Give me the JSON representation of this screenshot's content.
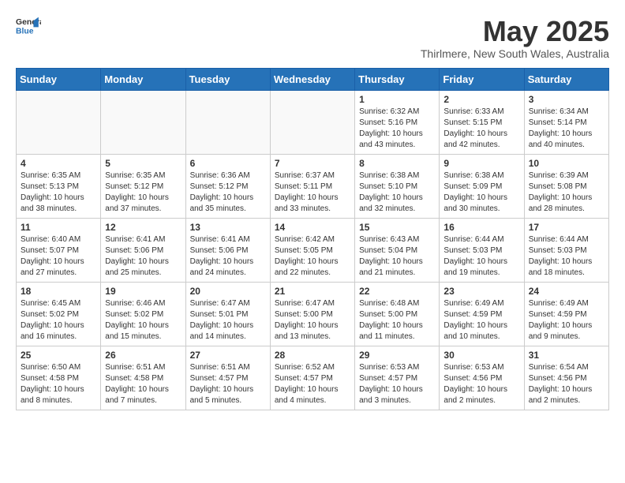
{
  "logo": {
    "line1": "General",
    "line2": "Blue"
  },
  "title": "May 2025",
  "subtitle": "Thirlmere, New South Wales, Australia",
  "days_header": [
    "Sunday",
    "Monday",
    "Tuesday",
    "Wednesday",
    "Thursday",
    "Friday",
    "Saturday"
  ],
  "weeks": [
    [
      {
        "num": "",
        "info": ""
      },
      {
        "num": "",
        "info": ""
      },
      {
        "num": "",
        "info": ""
      },
      {
        "num": "",
        "info": ""
      },
      {
        "num": "1",
        "info": "Sunrise: 6:32 AM\nSunset: 5:16 PM\nDaylight: 10 hours\nand 43 minutes."
      },
      {
        "num": "2",
        "info": "Sunrise: 6:33 AM\nSunset: 5:15 PM\nDaylight: 10 hours\nand 42 minutes."
      },
      {
        "num": "3",
        "info": "Sunrise: 6:34 AM\nSunset: 5:14 PM\nDaylight: 10 hours\nand 40 minutes."
      }
    ],
    [
      {
        "num": "4",
        "info": "Sunrise: 6:35 AM\nSunset: 5:13 PM\nDaylight: 10 hours\nand 38 minutes."
      },
      {
        "num": "5",
        "info": "Sunrise: 6:35 AM\nSunset: 5:12 PM\nDaylight: 10 hours\nand 37 minutes."
      },
      {
        "num": "6",
        "info": "Sunrise: 6:36 AM\nSunset: 5:12 PM\nDaylight: 10 hours\nand 35 minutes."
      },
      {
        "num": "7",
        "info": "Sunrise: 6:37 AM\nSunset: 5:11 PM\nDaylight: 10 hours\nand 33 minutes."
      },
      {
        "num": "8",
        "info": "Sunrise: 6:38 AM\nSunset: 5:10 PM\nDaylight: 10 hours\nand 32 minutes."
      },
      {
        "num": "9",
        "info": "Sunrise: 6:38 AM\nSunset: 5:09 PM\nDaylight: 10 hours\nand 30 minutes."
      },
      {
        "num": "10",
        "info": "Sunrise: 6:39 AM\nSunset: 5:08 PM\nDaylight: 10 hours\nand 28 minutes."
      }
    ],
    [
      {
        "num": "11",
        "info": "Sunrise: 6:40 AM\nSunset: 5:07 PM\nDaylight: 10 hours\nand 27 minutes."
      },
      {
        "num": "12",
        "info": "Sunrise: 6:41 AM\nSunset: 5:06 PM\nDaylight: 10 hours\nand 25 minutes."
      },
      {
        "num": "13",
        "info": "Sunrise: 6:41 AM\nSunset: 5:06 PM\nDaylight: 10 hours\nand 24 minutes."
      },
      {
        "num": "14",
        "info": "Sunrise: 6:42 AM\nSunset: 5:05 PM\nDaylight: 10 hours\nand 22 minutes."
      },
      {
        "num": "15",
        "info": "Sunrise: 6:43 AM\nSunset: 5:04 PM\nDaylight: 10 hours\nand 21 minutes."
      },
      {
        "num": "16",
        "info": "Sunrise: 6:44 AM\nSunset: 5:03 PM\nDaylight: 10 hours\nand 19 minutes."
      },
      {
        "num": "17",
        "info": "Sunrise: 6:44 AM\nSunset: 5:03 PM\nDaylight: 10 hours\nand 18 minutes."
      }
    ],
    [
      {
        "num": "18",
        "info": "Sunrise: 6:45 AM\nSunset: 5:02 PM\nDaylight: 10 hours\nand 16 minutes."
      },
      {
        "num": "19",
        "info": "Sunrise: 6:46 AM\nSunset: 5:02 PM\nDaylight: 10 hours\nand 15 minutes."
      },
      {
        "num": "20",
        "info": "Sunrise: 6:47 AM\nSunset: 5:01 PM\nDaylight: 10 hours\nand 14 minutes."
      },
      {
        "num": "21",
        "info": "Sunrise: 6:47 AM\nSunset: 5:00 PM\nDaylight: 10 hours\nand 13 minutes."
      },
      {
        "num": "22",
        "info": "Sunrise: 6:48 AM\nSunset: 5:00 PM\nDaylight: 10 hours\nand 11 minutes."
      },
      {
        "num": "23",
        "info": "Sunrise: 6:49 AM\nSunset: 4:59 PM\nDaylight: 10 hours\nand 10 minutes."
      },
      {
        "num": "24",
        "info": "Sunrise: 6:49 AM\nSunset: 4:59 PM\nDaylight: 10 hours\nand 9 minutes."
      }
    ],
    [
      {
        "num": "25",
        "info": "Sunrise: 6:50 AM\nSunset: 4:58 PM\nDaylight: 10 hours\nand 8 minutes."
      },
      {
        "num": "26",
        "info": "Sunrise: 6:51 AM\nSunset: 4:58 PM\nDaylight: 10 hours\nand 7 minutes."
      },
      {
        "num": "27",
        "info": "Sunrise: 6:51 AM\nSunset: 4:57 PM\nDaylight: 10 hours\nand 5 minutes."
      },
      {
        "num": "28",
        "info": "Sunrise: 6:52 AM\nSunset: 4:57 PM\nDaylight: 10 hours\nand 4 minutes."
      },
      {
        "num": "29",
        "info": "Sunrise: 6:53 AM\nSunset: 4:57 PM\nDaylight: 10 hours\nand 3 minutes."
      },
      {
        "num": "30",
        "info": "Sunrise: 6:53 AM\nSunset: 4:56 PM\nDaylight: 10 hours\nand 2 minutes."
      },
      {
        "num": "31",
        "info": "Sunrise: 6:54 AM\nSunset: 4:56 PM\nDaylight: 10 hours\nand 2 minutes."
      }
    ]
  ]
}
